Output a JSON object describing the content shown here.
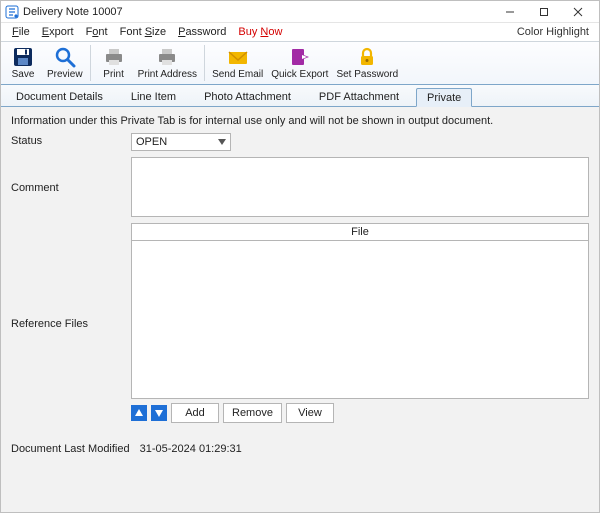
{
  "titlebar": {
    "title": "Delivery Note 10007"
  },
  "menubar": {
    "items": [
      {
        "pre": "",
        "u": "F",
        "post": "ile"
      },
      {
        "pre": "",
        "u": "E",
        "post": "xport"
      },
      {
        "pre": "F",
        "u": "o",
        "post": "nt"
      },
      {
        "pre": "Font ",
        "u": "S",
        "post": "ize"
      },
      {
        "pre": "",
        "u": "P",
        "post": "assword"
      }
    ],
    "buy_now": {
      "pre": "Buy ",
      "u": "N",
      "post": "ow"
    },
    "right_label": "Color Highlight"
  },
  "toolbar": {
    "save": "Save",
    "preview": "Preview",
    "print": "Print",
    "print_address": "Print Address",
    "send_email": "Send Email",
    "quick_export": "Quick Export",
    "set_password": "Set Password"
  },
  "tabs": {
    "items": [
      "Document Details",
      "Line Item",
      "Photo Attachment",
      "PDF Attachment",
      "Private"
    ],
    "active_index": 4
  },
  "private_tab": {
    "info_text": "Information under this Private Tab is for internal use only and will not be shown in output document.",
    "status_label": "Status",
    "status_value": "OPEN",
    "comment_label": "Comment",
    "reference_files_label": "Reference Files",
    "file_column_header": "File",
    "buttons": {
      "add": "Add",
      "remove": "Remove",
      "view": "View"
    },
    "last_modified_label": "Document Last Modified",
    "last_modified_value": "31-05-2024 01:29:31"
  }
}
